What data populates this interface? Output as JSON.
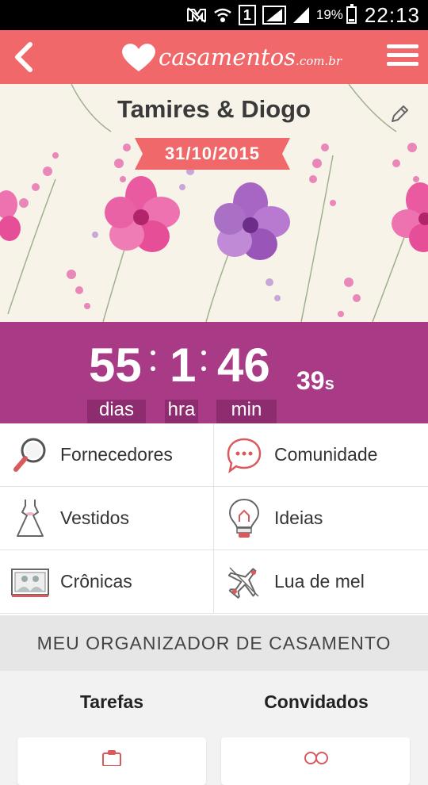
{
  "status_bar": {
    "sim": "1",
    "battery": "19%",
    "battery_level": 0.19,
    "time": "22:13",
    "icons": [
      "mute-icon",
      "wifi-icon",
      "sim-icon",
      "signal-icon",
      "signal-icon",
      "battery-icon"
    ]
  },
  "app_bar": {
    "logo_text": "casamentos",
    "logo_domain": ".com.br",
    "back_icon": "chevron-left-icon",
    "menu_icon": "hamburger-icon"
  },
  "hero": {
    "couple": "Tamires & Diogo",
    "date": "31/10/2015",
    "edit_icon": "pencil-icon"
  },
  "countdown": {
    "days": "55",
    "days_label": "dias",
    "hours": "1",
    "hours_label": "hra",
    "minutes": "46",
    "minutes_label": "min",
    "seconds": "39",
    "seconds_unit": "s"
  },
  "menu": [
    {
      "label": "Fornecedores",
      "icon": "magnifier-icon"
    },
    {
      "label": "Comunidade",
      "icon": "chat-bubble-icon"
    },
    {
      "label": "Vestidos",
      "icon": "dress-icon"
    },
    {
      "label": "Ideias",
      "icon": "lightbulb-icon"
    },
    {
      "label": "Crônicas",
      "icon": "photo-album-icon"
    },
    {
      "label": "Lua de mel",
      "icon": "airplane-icon"
    }
  ],
  "organizer": {
    "title": "MEU ORGANIZADOR DE CASAMENTO",
    "tabs": [
      {
        "label": "Tarefas"
      },
      {
        "label": "Convidados"
      }
    ]
  },
  "colors": {
    "app_bar": "#f0686a",
    "countdown": "#a83a86",
    "countdown_label": "#8d2c6f",
    "ribbon": "#f0686a"
  }
}
